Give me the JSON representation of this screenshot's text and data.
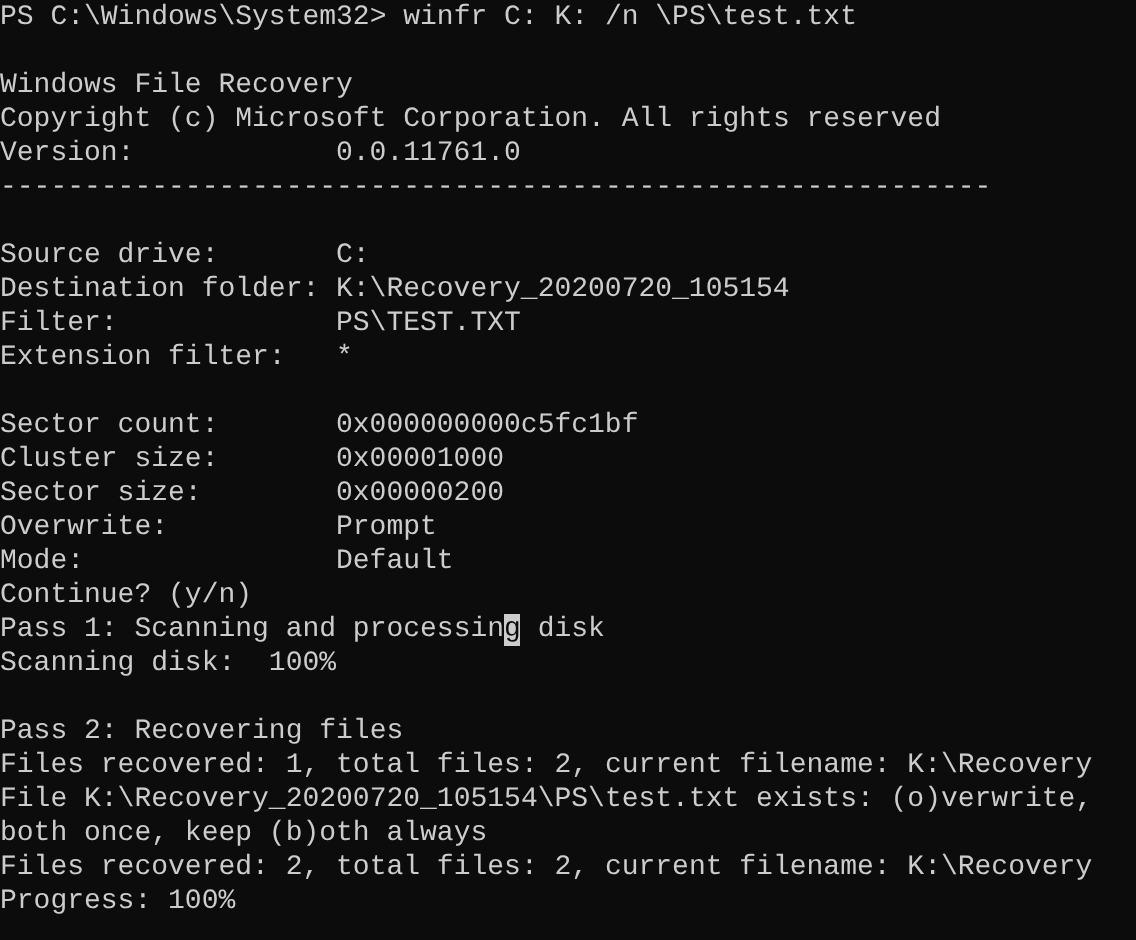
{
  "terminal": {
    "lines": [
      {
        "kind": "text",
        "text": "PS C:\\Windows\\System32> winfr C: K: /n \\PS\\test.txt"
      },
      {
        "kind": "blank"
      },
      {
        "kind": "text",
        "text": "Windows File Recovery"
      },
      {
        "kind": "text",
        "text": "Copyright (c) Microsoft Corporation. All rights reserved"
      },
      {
        "kind": "field",
        "label": "Version:",
        "value": "0.0.11761.0"
      },
      {
        "kind": "rule",
        "text": "-----------------------------------------------------------"
      },
      {
        "kind": "blank"
      },
      {
        "kind": "field",
        "label": "Source drive:",
        "value": "C:"
      },
      {
        "kind": "field",
        "label": "Destination folder:",
        "value": "K:\\Recovery_20200720_105154"
      },
      {
        "kind": "field",
        "label": "Filter:",
        "value": "PS\\TEST.TXT"
      },
      {
        "kind": "field",
        "label": "Extension filter:",
        "value": "*"
      },
      {
        "kind": "blank"
      },
      {
        "kind": "field",
        "label": "Sector count:",
        "value": "0x000000000c5fc1bf"
      },
      {
        "kind": "field",
        "label": "Cluster size:",
        "value": "0x00001000"
      },
      {
        "kind": "field",
        "label": "Sector size:",
        "value": "0x00000200"
      },
      {
        "kind": "field",
        "label": "Overwrite:",
        "value": "Prompt"
      },
      {
        "kind": "field",
        "label": "Mode:",
        "value": "Default"
      },
      {
        "kind": "text",
        "text": "Continue? (y/n)"
      },
      {
        "kind": "cursor",
        "before": "Pass 1: Scanning and processin",
        "cursor": "g",
        "after": " disk"
      },
      {
        "kind": "text",
        "text": "Scanning disk:  100%"
      },
      {
        "kind": "blank"
      },
      {
        "kind": "text",
        "text": "Pass 2: Recovering files"
      },
      {
        "kind": "text",
        "text": "Files recovered: 1, total files: 2, current filename: K:\\Recovery"
      },
      {
        "kind": "text",
        "text": "File K:\\Recovery_20200720_105154\\PS\\test.txt exists: (o)verwrite,"
      },
      {
        "kind": "text",
        "text": "both once, keep (b)oth always"
      },
      {
        "kind": "text",
        "text": "Files recovered: 2, total files: 2, current filename: K:\\Recovery"
      },
      {
        "kind": "text",
        "text": "Progress: 100%"
      }
    ]
  }
}
